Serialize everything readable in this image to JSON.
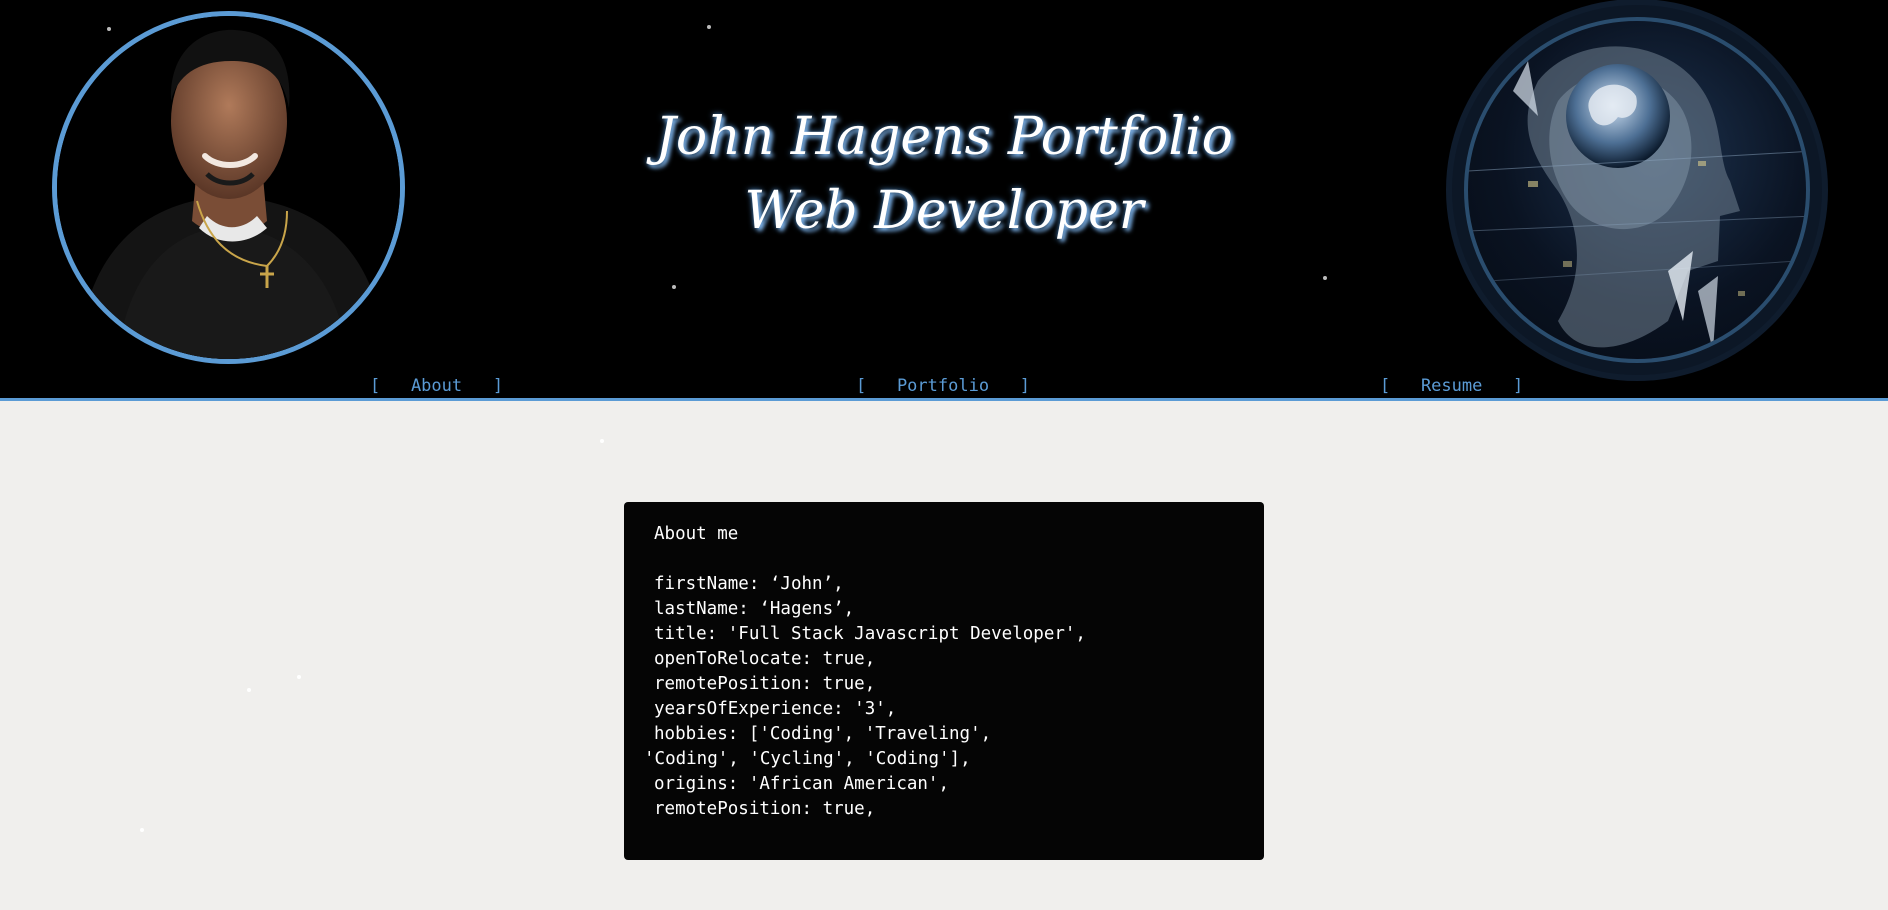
{
  "header": {
    "title_line1": "John Hagens Portfolio",
    "title_line2": "Web Developer",
    "accent_color": "#5b9bd5",
    "avatar": {
      "description_icon": "profile-photo"
    },
    "globe": {
      "description_icon": "digital-head-globe"
    }
  },
  "nav": {
    "about": "[   About   ]",
    "portfolio": "[   Portfolio   ]",
    "resume": "[   Resume   ]"
  },
  "about_panel": {
    "heading": "About me",
    "lines": [
      "firstName: ‘John’,",
      "lastName: ‘Hagens’,",
      "title: 'Full Stack Javascript Developer',",
      "openToRelocate: true,",
      "remotePosition: true,",
      "yearsOfExperience: '3',",
      "hobbies: ['Coding', 'Traveling',",
      "'Coding', 'Cycling', 'Coding'],",
      "origins: 'African American',",
      "remotePosition: true,"
    ]
  }
}
